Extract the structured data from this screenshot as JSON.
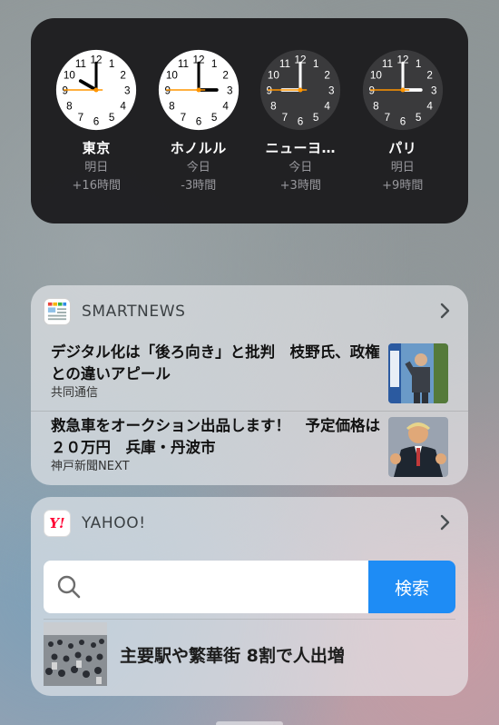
{
  "world_clock": {
    "clocks": [
      {
        "city": "東京",
        "day": "明日",
        "offset": "+16時間",
        "theme": "light",
        "hour": 10,
        "minute": 0,
        "second": 45
      },
      {
        "city": "ホノルル",
        "day": "今日",
        "offset": "-3時間",
        "theme": "light",
        "hour": 15,
        "minute": 0,
        "second": 45
      },
      {
        "city": "ニューヨ…",
        "day": "今日",
        "offset": "+3時間",
        "theme": "dark",
        "hour": 21,
        "minute": 0,
        "second": 45
      },
      {
        "city": "パリ",
        "day": "明日",
        "offset": "+9時間",
        "theme": "dark",
        "hour": 3,
        "minute": 0,
        "second": 45
      }
    ]
  },
  "smartnews": {
    "app_name": "SMARTNEWS",
    "icon": "smartnews-app-icon",
    "items": [
      {
        "title": "デジタル化は「後ろ向き」と批判　枝野氏、政権との違いアピール",
        "source": "共同通信"
      },
      {
        "title": "救急車をオークション出品します！　予定価格は２０万円　兵庫・丹波市",
        "source": "神戸新聞NEXT"
      }
    ]
  },
  "yahoo": {
    "app_name": "YAHOO!",
    "icon_text": "Y!",
    "search_placeholder": "",
    "search_button": "検索",
    "headline": "主要駅や繁華街 8割で人出増"
  },
  "colors": {
    "clock_widget_bg": "#1c1c1e",
    "search_button": "#1e8cf5",
    "clock_second_hand": "#ff9500"
  }
}
